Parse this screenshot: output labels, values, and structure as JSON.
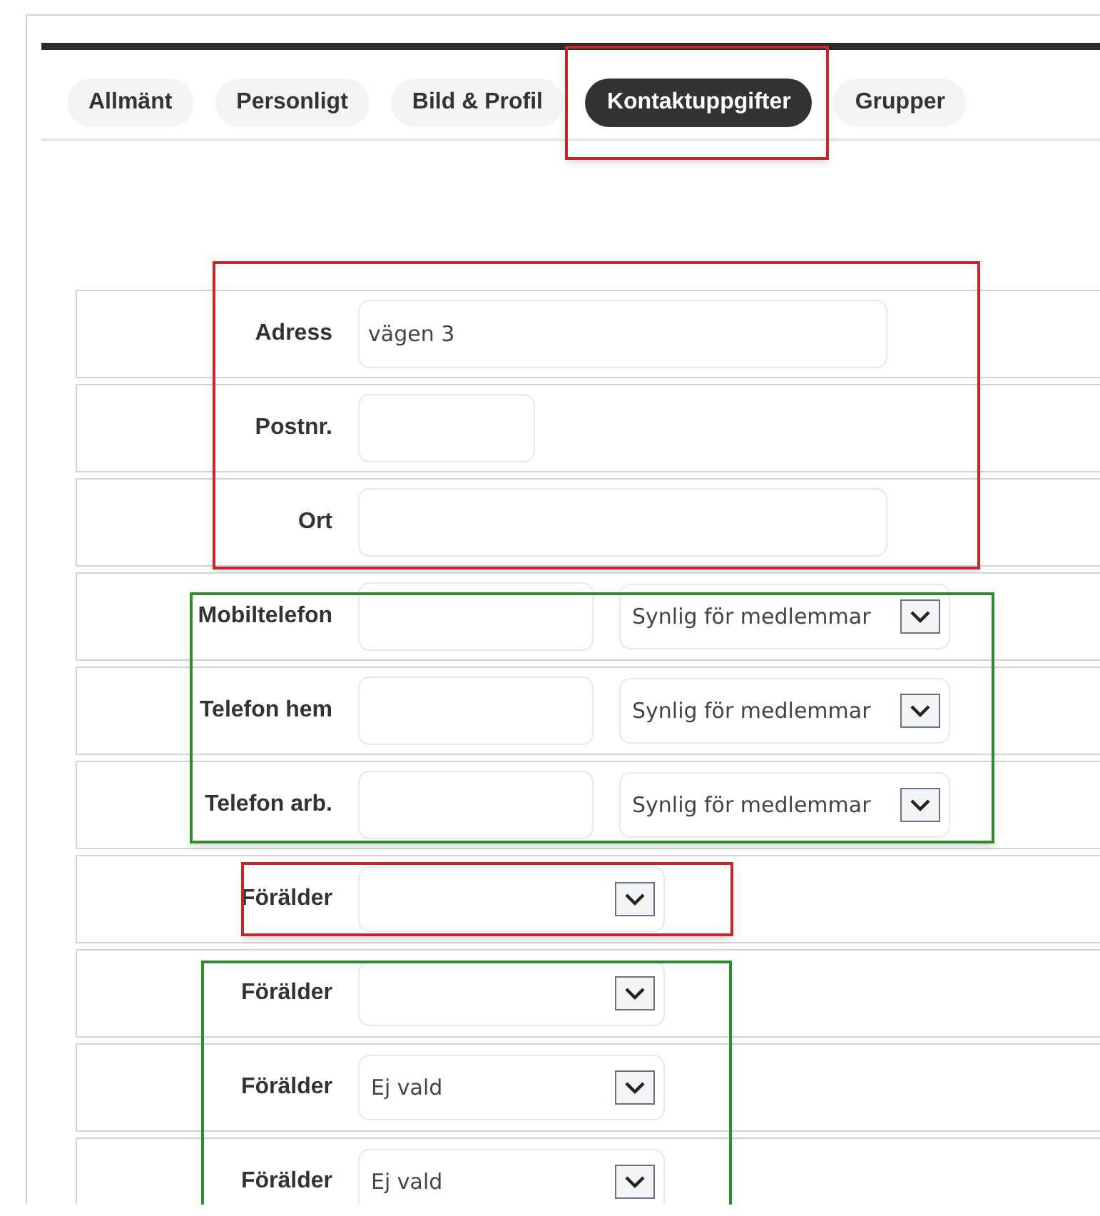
{
  "tabs": [
    {
      "label": "Allmänt",
      "selected": false
    },
    {
      "label": "Personligt",
      "selected": false
    },
    {
      "label": "Bild & Profil",
      "selected": false
    },
    {
      "label": "Kontaktuppgifter",
      "selected": true,
      "color": "#c0282d"
    },
    {
      "label": "Grupper",
      "selected": false
    }
  ],
  "sections": [
    {
      "kind": "address",
      "color": "#c0282d",
      "rows": [
        {
          "kind": "text",
          "label": "Adress",
          "value": "vägen 3"
        },
        {
          "kind": "shorttext",
          "label": "Postnr."
        },
        {
          "kind": "text",
          "label": "Ort"
        }
      ]
    },
    {
      "kind": "phones",
      "color": "#2e8b2e",
      "rows": [
        {
          "kind": "phone",
          "label": "Mobiltelefon",
          "visibility": "Synlig för medlemmar"
        },
        {
          "kind": "phone",
          "label": "Telefon hem",
          "visibility": "Synlig för medlemmar"
        },
        {
          "kind": "phone",
          "label": "Telefon arb.",
          "visibility": "Synlig för medlemmar"
        }
      ]
    },
    {
      "kind": "parent",
      "color": "#c0282d",
      "rows": [
        {
          "kind": "parent",
          "label": "Förälder"
        }
      ]
    },
    {
      "kind": "parents",
      "color": "#2e8b2e",
      "rows": [
        {
          "kind": "parent",
          "label": "Förälder"
        },
        {
          "kind": "parent",
          "label": "Förälder",
          "value": "Ej vald"
        },
        {
          "kind": "parent",
          "label": "Förälder",
          "value": "Ej vald"
        }
      ]
    }
  ]
}
